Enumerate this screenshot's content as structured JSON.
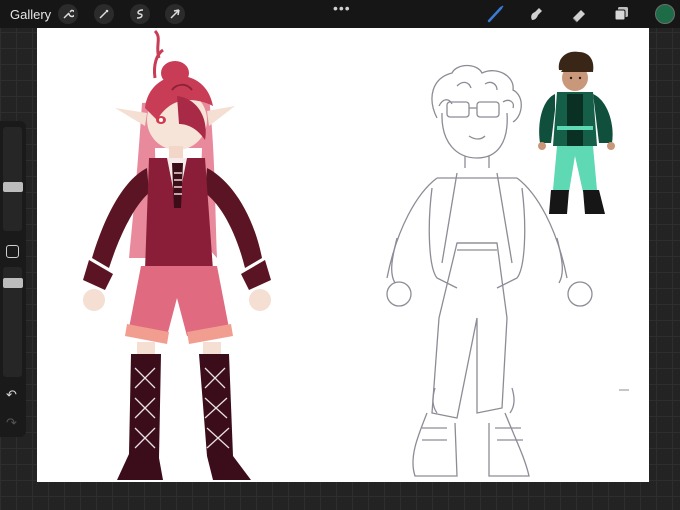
{
  "app": {
    "gallery_label": "Gallery",
    "more_dots": "•••"
  },
  "toolbar": {
    "left_tools": [
      {
        "name": "wrench-icon",
        "glyph": "✎"
      },
      {
        "name": "magic-wand-icon",
        "glyph": "✦"
      },
      {
        "name": "selection-icon",
        "glyph": "S"
      },
      {
        "name": "transform-icon",
        "glyph": "➚"
      }
    ],
    "right_tools": [
      "brush-icon",
      "smudge-icon",
      "eraser-icon",
      "layers-icon"
    ],
    "active_tool": "brush-icon",
    "accent": "#3a7bd5",
    "current_color": "#1d6b47"
  },
  "sidebar": {
    "modify_glyph": "",
    "undo_glyph": "↶",
    "redo_glyph": "↷"
  },
  "colors": {
    "red_hair": "#d44a5e",
    "maroon": "#5a1423",
    "pink": "#e06a80",
    "sketch": "#8c8c96",
    "teal_jacket": "#0f4f3c",
    "mint": "#5fd8b4"
  }
}
